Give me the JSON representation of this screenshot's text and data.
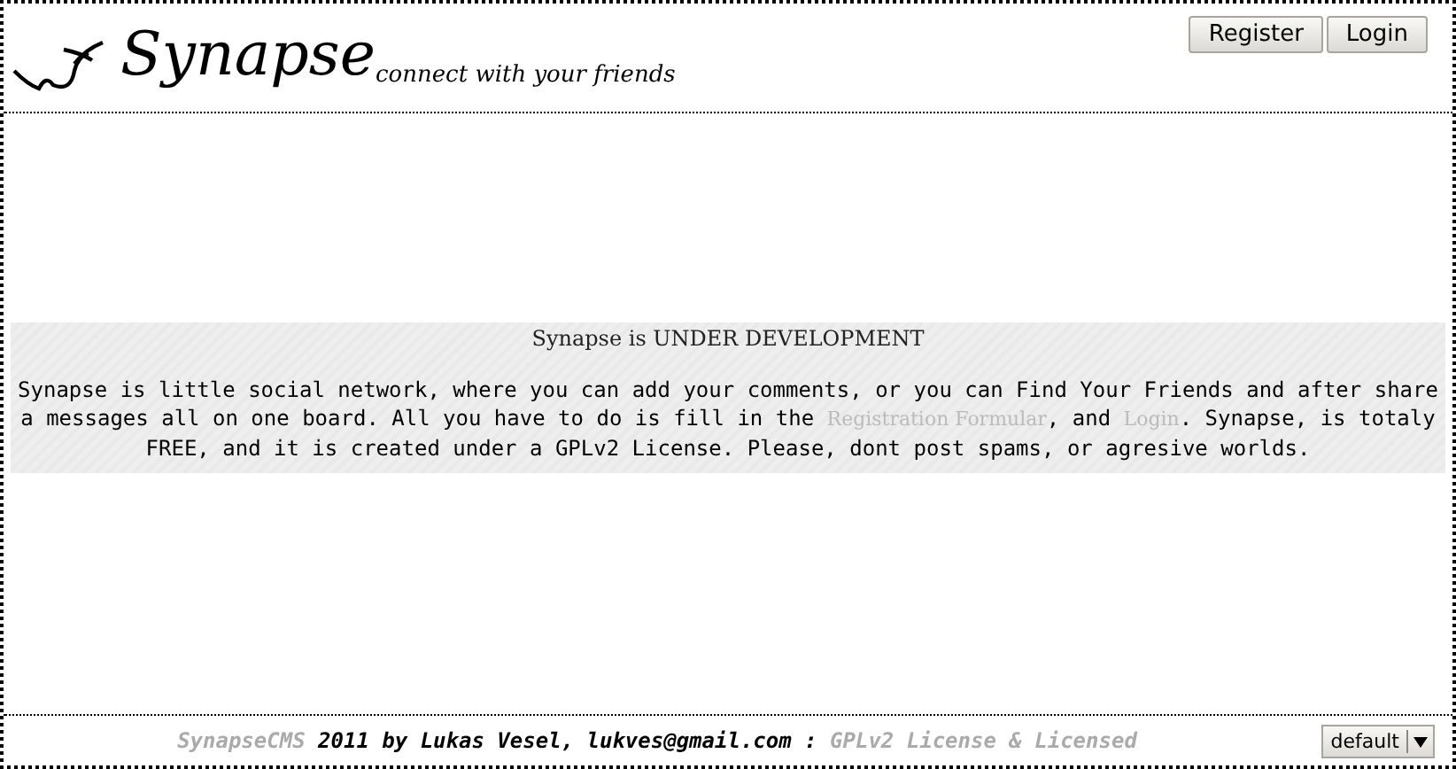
{
  "header": {
    "logo_text": "Synapse",
    "tagline": "connect with your friends",
    "buttons": [
      {
        "label": "Register"
      },
      {
        "label": "Login"
      }
    ]
  },
  "notice": {
    "title": "Synapse is UNDER DEVELOPMENT",
    "parts": [
      {
        "kind": "text",
        "text": "Synapse is little social network, where you can add your comments, or you can Find Your Friends and after share a messages all on one board. All you have to do is fill in the "
      },
      {
        "kind": "link",
        "text": "Registration Formular"
      },
      {
        "kind": "text",
        "text": ", and "
      },
      {
        "kind": "link",
        "text": "Login"
      },
      {
        "kind": "text",
        "text": ". Synapse, is totaly FREE, and it is created under a GPLv2 License. Please, dont post spams, or agresive worlds."
      }
    ]
  },
  "footer": {
    "parts": [
      {
        "kind": "link",
        "text": "SynapseCMS"
      },
      {
        "kind": "text",
        "text": " 2011 by Lukas Vesel, lukves@gmail.com : "
      },
      {
        "kind": "link",
        "text": "GPLv2 License & Licensed"
      }
    ],
    "theme_select": {
      "value": "default"
    }
  }
}
